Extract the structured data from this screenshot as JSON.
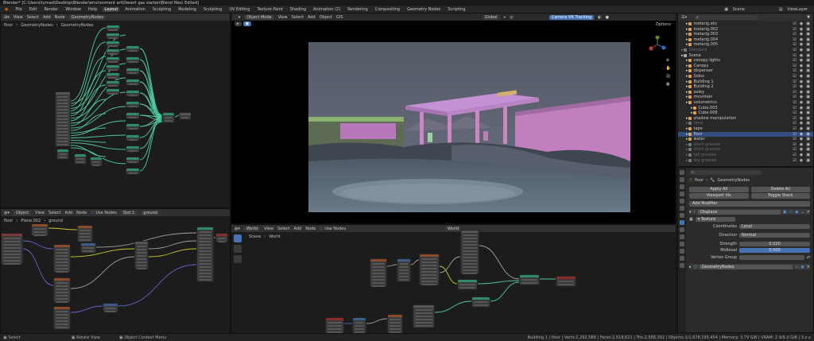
{
  "titlebar": {
    "text": "Blender* [C:\\Users\\tymad\\Desktop\\Blender\\environment art\\Desert gas station\\Blend files\\ Edited]"
  },
  "menu": [
    "File",
    "Edit",
    "Render",
    "Window",
    "Help"
  ],
  "workspaces": [
    "Layout",
    "Animation",
    "Sculpting",
    "Modeling",
    "Sculpting",
    "UV Editing",
    "Texture Paint",
    "Shading",
    "Animation (2)",
    "Rendering",
    "Compositing",
    "Geometry Nodes",
    "Scripting"
  ],
  "active_workspace_index": 0,
  "scene": "Scene",
  "viewlayer": "ViewLayer",
  "geo_editor": {
    "object": "floor",
    "modifier": "GeometryNodes",
    "group": "GeometryNodes"
  },
  "viewport": {
    "mode": "Object Mode",
    "menus": [
      "View",
      "Select",
      "Add",
      "Object",
      "GIS"
    ],
    "transform": "Global",
    "addon_button": "Camera VR Tracking",
    "options": "Options"
  },
  "shader_editor": {
    "type": "Object",
    "menus": [
      "View",
      "Select",
      "Add",
      "Node"
    ],
    "use_nodes": "Use Nodes",
    "slot": "Slot 1",
    "material": "ground",
    "object": "floor",
    "mesh": "Plane.002",
    "mat_crumb": "ground"
  },
  "world_editor": {
    "type": "World",
    "menus": [
      "View",
      "Select",
      "Add",
      "Node"
    ],
    "use_nodes": "Use Nodes",
    "world": "World",
    "crumb_scene": "Scene",
    "crumb_world": "World"
  },
  "outliner": {
    "rows": [
      {
        "label": "metarig.eto",
        "indent": 1,
        "color": "#e0a050"
      },
      {
        "label": "metarig.002",
        "indent": 1,
        "color": "#e0a050"
      },
      {
        "label": "metarig.003",
        "indent": 1,
        "color": "#e0a050"
      },
      {
        "label": "metarig.004",
        "indent": 1,
        "color": "#e0a050"
      },
      {
        "label": "metarig.005",
        "indent": 1,
        "color": "#e0a050"
      },
      {
        "label": "Standard",
        "indent": 0,
        "color": "#777",
        "dim": true
      },
      {
        "label": "Scene",
        "indent": 0,
        "color": "#aaa"
      },
      {
        "label": "canopy lights",
        "indent": 1,
        "color": "#e0a050"
      },
      {
        "label": "Canopy",
        "indent": 1,
        "color": "#e0a050"
      },
      {
        "label": "dispenser",
        "indent": 1,
        "color": "#e0a050"
      },
      {
        "label": "Solos",
        "indent": 1,
        "color": "#e0a050"
      },
      {
        "label": "Building 1",
        "indent": 1,
        "color": "#e0a050"
      },
      {
        "label": "Building 2",
        "indent": 1,
        "color": "#e0a050"
      },
      {
        "label": "aaley",
        "indent": 1,
        "color": "#e0a050"
      },
      {
        "label": "mountain",
        "indent": 1,
        "color": "#e0a050"
      },
      {
        "label": "volumetrics",
        "indent": 1,
        "color": "#e0a050"
      },
      {
        "label": "Cube.003",
        "indent": 2,
        "color": "#e0a050"
      },
      {
        "label": "Cube.008",
        "indent": 2,
        "color": "#e0a050"
      },
      {
        "label": "shadow manipulation",
        "indent": 1,
        "color": "#e0a050"
      },
      {
        "label": "tand",
        "indent": 1,
        "color": "#777",
        "dim": true
      },
      {
        "label": "tape",
        "indent": 1,
        "color": "#e0a050"
      },
      {
        "label": "floor",
        "indent": 1,
        "color": "#e0a050",
        "selected": true
      },
      {
        "label": "water",
        "indent": 1,
        "color": "#e0a050"
      },
      {
        "label": "short grasses",
        "indent": 1,
        "color": "#777",
        "dim": true
      },
      {
        "label": "short grasses",
        "indent": 1,
        "color": "#777",
        "dim": true
      },
      {
        "label": "tall grasses",
        "indent": 1,
        "color": "#777",
        "dim": true
      },
      {
        "label": "dry grasses",
        "indent": 1,
        "color": "#777",
        "dim": true
      }
    ]
  },
  "properties": {
    "object": "floor",
    "modifier_name": "GeometryNodes",
    "apply_all": "Apply All",
    "delete_all": "Delete All",
    "viewport_vis": "Viewport Vis",
    "toggle_stack": "Toggle Stack",
    "add_modifier": "Add Modifier",
    "displace_name": "Displace",
    "texture_label": "Texture",
    "coordinates_label": "Coordinates",
    "coordinates_value": "Local",
    "direction_label": "Direction",
    "direction_value": "Normal",
    "strength_label": "Strength",
    "strength_value": "0.020",
    "midlevel_label": "Midlevel",
    "midlevel_value": "0.500",
    "vgroup_label": "Vertex Group",
    "geo_modifier": "GeometryNodes"
  },
  "status": {
    "left": "Select",
    "mid1": "Rotate View",
    "mid2": "Object Context Menu",
    "right": "Building 1 | floor | Verts:1,292,588 | Faces:2,518,621 | Tris:2,588,292 | Objects:1/1,678,195,454 | Memory: 3.79 GiB | VRAM: 2.9/6.0 GiB | 3.x.x"
  },
  "colors": {
    "accent": "#4772b3",
    "wire_green": "#4ec9a0",
    "wire_yellow": "#c7c729",
    "wire_purple": "#6363c7",
    "wire_grey": "#a1a1a1"
  }
}
